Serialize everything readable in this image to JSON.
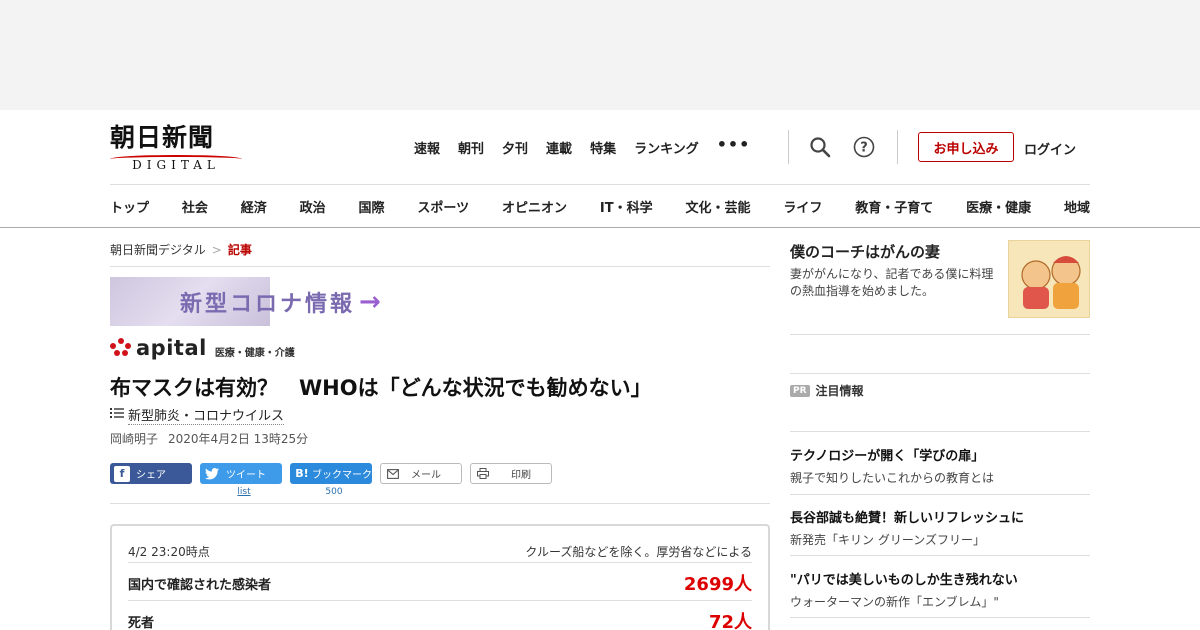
{
  "header": {
    "logo_main": "朝日新聞",
    "logo_sub": "DIGITAL",
    "topnav": [
      "速報",
      "朝刊",
      "夕刊",
      "連載",
      "特集",
      "ランキング"
    ],
    "more_label": "•••",
    "apply_label": "お申し込み",
    "login_label": "ログイン"
  },
  "categories": [
    "トップ",
    "社会",
    "経済",
    "政治",
    "国際",
    "スポーツ",
    "オピニオン",
    "IT・科学",
    "文化・芸能",
    "ライフ",
    "教育・子育て",
    "医療・健康",
    "地域"
  ],
  "breadcrumb": {
    "home": "朝日新聞デジタル",
    "current": "記事"
  },
  "banner": {
    "text": "新型コロナ情報",
    "arrow": "→"
  },
  "apital": {
    "name": "apital",
    "category": "医療・健康・介護"
  },
  "article": {
    "headline": "布マスクは有効？　WHOは「どんな状況でも勧めない」",
    "topic": "新型肺炎・コロナウイルス",
    "author": "岡崎明子",
    "date": "2020年4月2日 13時25分"
  },
  "share": {
    "facebook": "シェア",
    "twitter": "ツイート",
    "twitter_count": "list",
    "hatena": "ブックマーク",
    "hatena_count": "500",
    "mail": "メール",
    "print": "印刷"
  },
  "stats": {
    "as_of": "4/2 23:20時点",
    "note": "クルーズ船などを除く。厚労省などによる",
    "rows": [
      {
        "label": "国内で確認された感染者",
        "value": "2699人"
      },
      {
        "label": "死者",
        "value": "72人"
      }
    ]
  },
  "sidebar": {
    "promo_title": "僕のコーチはがんの妻",
    "promo_desc": "妻ががんになり、記者である僕に料理の熱血指導を始めました。",
    "pr_badge": "PR",
    "pr_label": "注目情報",
    "items": [
      {
        "title": "テクノロジーが開く「学びの扉」",
        "sub": "親子で知りしたいこれからの教育とは"
      },
      {
        "title": "長谷部誠も絶賛！新しいリフレッシュに",
        "sub": "新発売「キリン グリーンズフリー」"
      },
      {
        "title": "\"パリでは美しいものしか生き残れない",
        "sub": "ウォーターマンの新作「エンブレム」\""
      }
    ]
  }
}
